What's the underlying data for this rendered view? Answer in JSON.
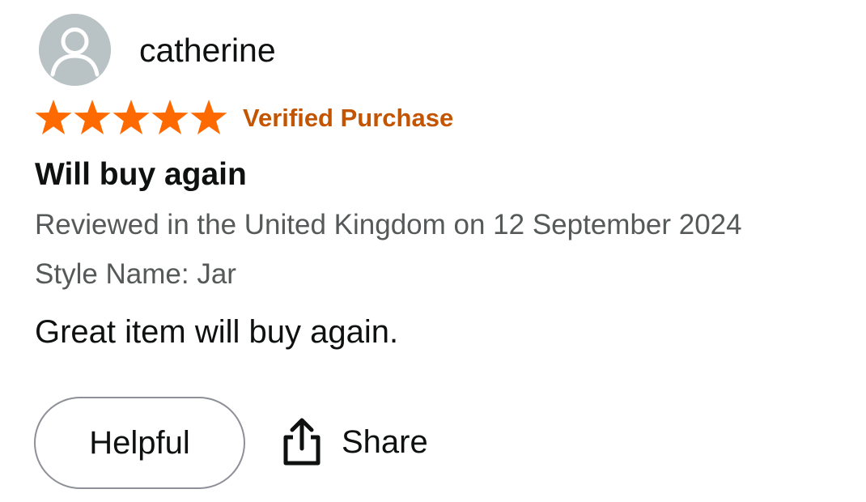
{
  "review": {
    "reviewer_name": "catherine",
    "avatar_icon": "default-user-icon",
    "rating": 5,
    "rating_max": 5,
    "star_color": "#ff6a00",
    "verified_label": "Verified Purchase",
    "verified_color": "#c45500",
    "title": "Will buy again",
    "review_meta": "Reviewed in the United Kingdom on 12 September 2024",
    "style_info": "Style Name: Jar",
    "body": "Great item will buy again."
  },
  "actions": {
    "helpful_label": "Helpful",
    "share_label": "Share",
    "share_icon": "share-icon"
  }
}
